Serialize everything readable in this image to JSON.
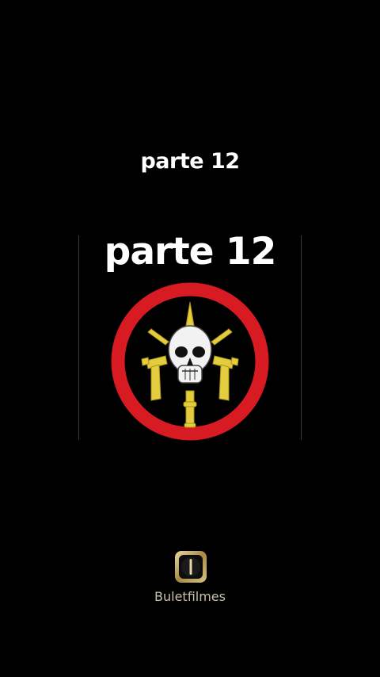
{
  "captions": {
    "top": "parte 12",
    "video": "parte 12"
  },
  "emblem": {
    "icon": "skull-crossed-pistols-dagger-emblem",
    "ring_color": "#d81b23",
    "gold_color": "#e3cd3f"
  },
  "branding": {
    "logo_icon": "buletfilmes-logo-icon",
    "name": "Buletfilmes"
  },
  "colors": {
    "background": "#000000",
    "text": "#ffffff",
    "brand_text": "#c9c0a8"
  }
}
